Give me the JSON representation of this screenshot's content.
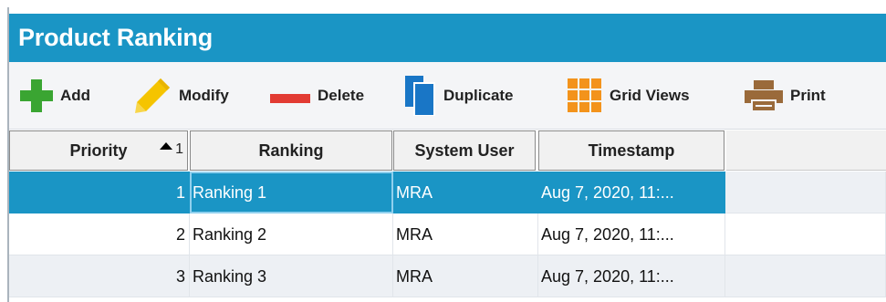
{
  "window": {
    "title": "Product Ranking"
  },
  "toolbar": {
    "add": "Add",
    "modify": "Modify",
    "delete": "Delete",
    "duplicate": "Duplicate",
    "grid_views": "Grid Views",
    "print": "Print"
  },
  "colors": {
    "accent": "#1a95c5",
    "add_icon": "#3aa532",
    "modify_icon": "#f5c400",
    "delete_icon": "#e23b33",
    "duplicate_icon": "#1976c6",
    "grid_icon": "#f3931b",
    "print_icon": "#9a6a3a"
  },
  "grid": {
    "columns": [
      "Priority",
      "Ranking",
      "System User",
      "Timestamp"
    ],
    "sort_indicator": "1",
    "rows": [
      {
        "priority": "1",
        "ranking": "Ranking 1",
        "user": "MRA",
        "timestamp": "Aug 7, 2020, 11:..."
      },
      {
        "priority": "2",
        "ranking": "Ranking 2",
        "user": "MRA",
        "timestamp": "Aug 7, 2020, 11:..."
      },
      {
        "priority": "3",
        "ranking": "Ranking 3",
        "user": "MRA",
        "timestamp": "Aug 7, 2020, 11:..."
      }
    ]
  }
}
